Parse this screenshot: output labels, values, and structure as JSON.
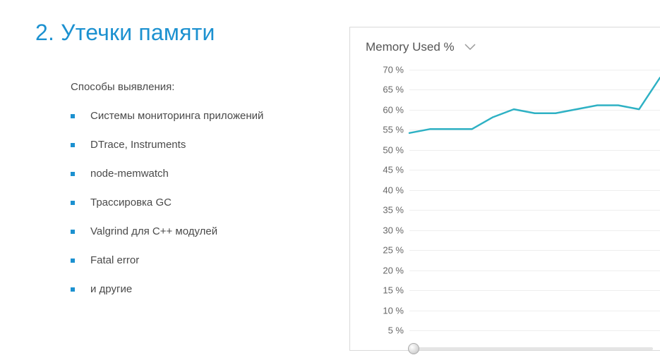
{
  "title": "2. Утечки памяти",
  "subhead": "Способы выявления:",
  "bullets": [
    "Системы мониторинга приложений",
    "DTrace, Instruments",
    "node-memwatch",
    "Трассировка GC",
    "Valgrind для C++ модулей",
    "Fatal error",
    "и другие"
  ],
  "chart_title": "Memory Used %",
  "chart_data": {
    "type": "line",
    "title": "Memory Used %",
    "xlabel": "",
    "ylabel": "",
    "ylim": [
      5,
      70
    ],
    "y_ticks": [
      "70 %",
      "65 %",
      "60 %",
      "55 %",
      "50 %",
      "45 %",
      "40 %",
      "35 %",
      "30 %",
      "25 %",
      "20 %",
      "15 %",
      "10 %",
      "5 %"
    ],
    "x": [
      0,
      1,
      2,
      3,
      4,
      5,
      6,
      7,
      8,
      9,
      10,
      11,
      12
    ],
    "values": [
      54,
      55,
      55,
      55,
      58,
      60,
      59,
      59,
      60,
      61,
      61,
      60,
      68
    ]
  },
  "colors": {
    "accent": "#1c91d0",
    "line": "#2eb1c4"
  }
}
